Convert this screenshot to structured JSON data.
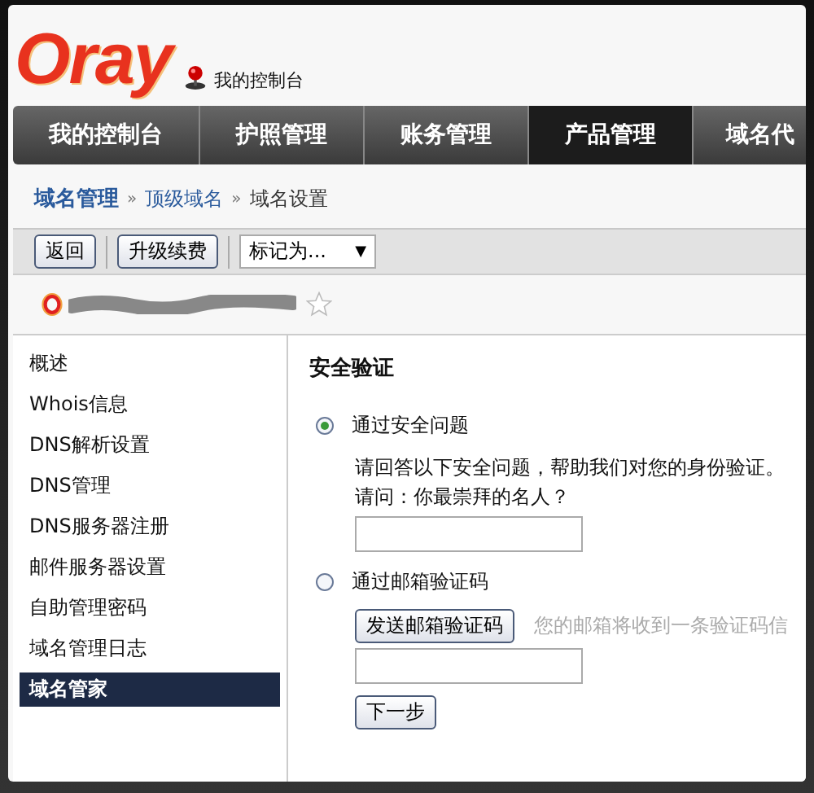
{
  "header": {
    "logo": "Oray",
    "console_link": "我的控制台"
  },
  "nav": [
    {
      "label": "我的控制台",
      "selected": false
    },
    {
      "label": "护照管理",
      "selected": false
    },
    {
      "label": "账务管理",
      "selected": false
    },
    {
      "label": "产品管理",
      "selected": true
    },
    {
      "label": "域名代",
      "selected": false
    }
  ],
  "breadcrumb": [
    {
      "label": "域名管理",
      "kind": "root"
    },
    {
      "label": "顶级域名",
      "kind": "link"
    },
    {
      "label": "域名设置",
      "kind": "current"
    }
  ],
  "breadcrumb_separator": "»",
  "toolbar": {
    "buttons": [
      "返回",
      "升级续费"
    ],
    "dropdown": {
      "value": "标记为...",
      "arrow": "▼"
    }
  },
  "domain": {
    "starred": false
  },
  "sidebar": {
    "items": [
      {
        "label": "概述",
        "selected": false
      },
      {
        "label": "Whois信息",
        "selected": false
      },
      {
        "label": "DNS解析设置",
        "selected": false
      },
      {
        "label": "DNS管理",
        "selected": false
      },
      {
        "label": "DNS服务器注册",
        "selected": false
      },
      {
        "label": "邮件服务器设置",
        "selected": false
      },
      {
        "label": "自助管理密码",
        "selected": false
      },
      {
        "label": "域名管理日志",
        "selected": false
      },
      {
        "label": "域名管家",
        "selected": true
      }
    ]
  },
  "content": {
    "title": "安全验证",
    "options": [
      {
        "label": "通过安全问题",
        "selected": true,
        "kind": "question",
        "hint": "请回答以下安全问题，帮助我们对您的身份验证。",
        "question": "请问：你最崇拜的名人？"
      },
      {
        "label": "通过邮箱验证码",
        "selected": false,
        "kind": "email",
        "button": "发送邮箱验证码",
        "note": "您的邮箱将收到一条验证码信"
      }
    ],
    "next_button": "下一步"
  }
}
